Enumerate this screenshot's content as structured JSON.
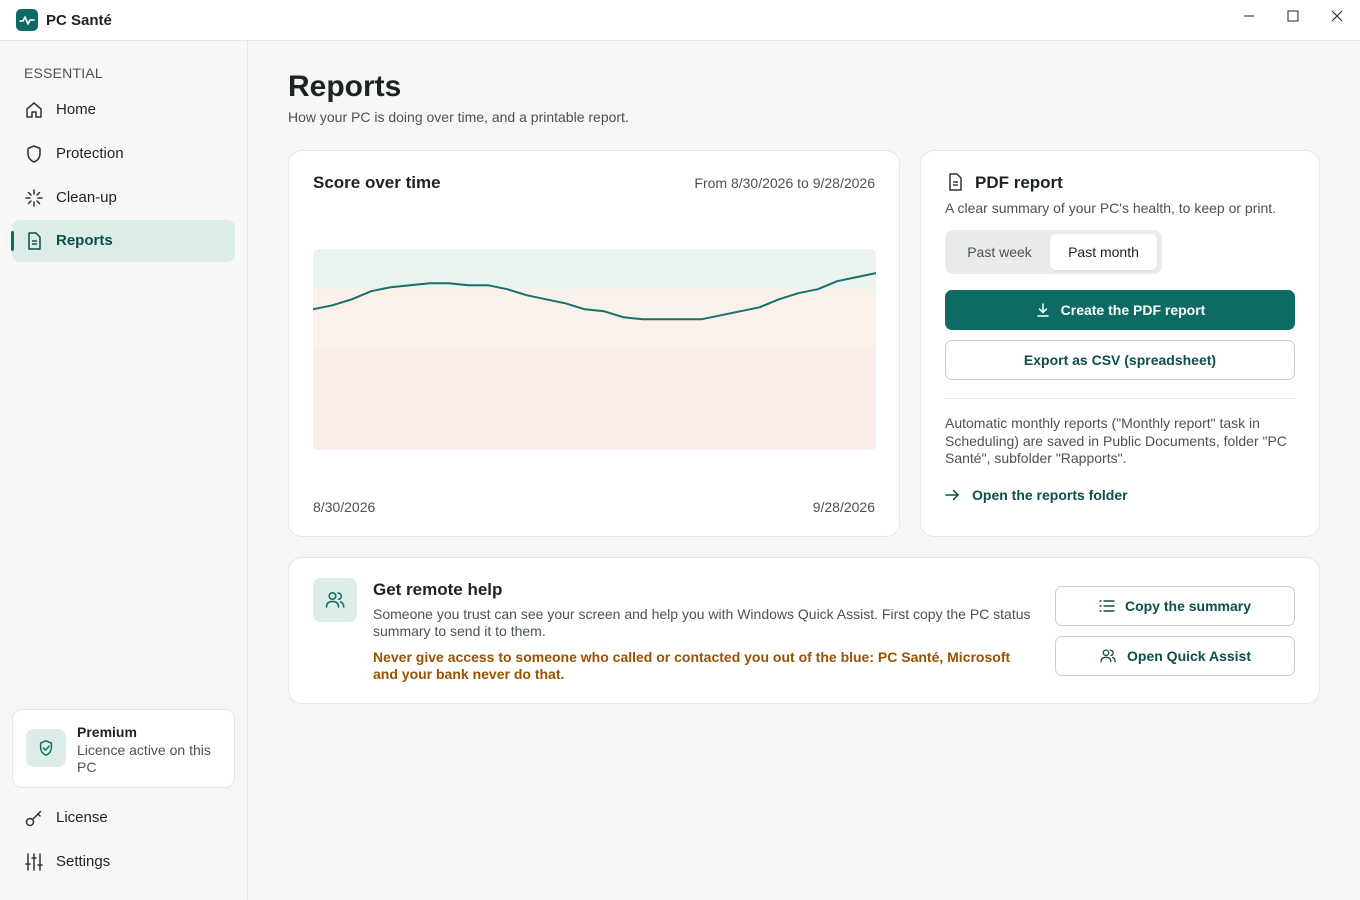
{
  "app": {
    "title": "PC Santé"
  },
  "sidebar": {
    "section_label": "ESSENTIAL",
    "items": [
      {
        "label": "Home",
        "icon": "home-icon"
      },
      {
        "label": "Protection",
        "icon": "shield-icon"
      },
      {
        "label": "Clean-up",
        "icon": "sparkle-icon"
      },
      {
        "label": "Reports",
        "icon": "document-icon",
        "active": true
      }
    ],
    "premium": {
      "title": "Premium",
      "subtitle": "Licence active on this PC"
    },
    "bottom_items": [
      {
        "label": "License",
        "icon": "key-icon"
      },
      {
        "label": "Settings",
        "icon": "sliders-icon"
      }
    ]
  },
  "page": {
    "title": "Reports",
    "subtitle": "How your PC is doing over time, and a printable report."
  },
  "score_card": {
    "title": "Score over time",
    "range": "From 8/30/2026 to 9/28/2026",
    "start_label": "8/30/2026",
    "end_label": "9/28/2026"
  },
  "chart_data": {
    "type": "line",
    "title": "Score over time",
    "x_start": "8/30/2026",
    "x_end": "9/28/2026",
    "y_range": [
      0,
      100
    ],
    "bands": [
      {
        "from": 80,
        "to": 100,
        "color": "#eaf3ee"
      },
      {
        "from": 50,
        "to": 80,
        "color": "#faf1ea"
      },
      {
        "from": 0,
        "to": 50,
        "color": "#f8ebe8"
      }
    ],
    "series": [
      {
        "color": "#17706a",
        "values": [
          70,
          72,
          75,
          79,
          81,
          82,
          83,
          83,
          82,
          82,
          80,
          77,
          75,
          73,
          70,
          69,
          66,
          65,
          65,
          65,
          65,
          67,
          69,
          71,
          75,
          78,
          80,
          84,
          86,
          88
        ]
      }
    ]
  },
  "pdf_card": {
    "title": "PDF report",
    "description": "A clear summary of your PC's health, to keep or print.",
    "periods": [
      {
        "label": "Past week",
        "active": false
      },
      {
        "label": "Past month",
        "active": true
      }
    ],
    "create_label": "Create the PDF report",
    "export_label": "Export as CSV (spreadsheet)",
    "note": "Automatic monthly reports (\"Monthly report\" task in Scheduling) are saved in Public Documents, folder \"PC Santé\", subfolder \"Rapports\".",
    "folder_link": "Open the reports folder"
  },
  "help_card": {
    "title": "Get remote help",
    "description": "Someone you trust can see your screen and help you with Windows Quick Assist. First copy the PC status summary to send it to them.",
    "warning": "Never give access to someone who called or contacted you out of the blue: PC Santé, Microsoft and your bank never do that.",
    "copy_label": "Copy the summary",
    "assist_label": "Open Quick Assist"
  }
}
